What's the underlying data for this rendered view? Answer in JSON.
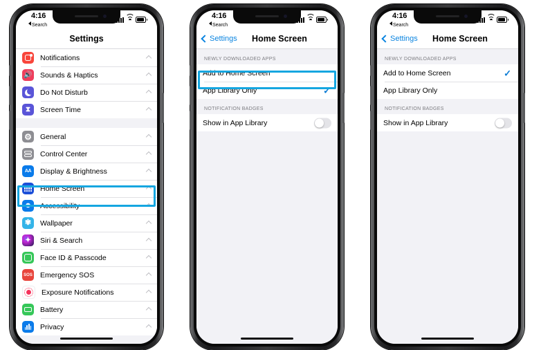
{
  "statusbar": {
    "time": "4:16",
    "back_label": "Search",
    "signal_icon": "cellular-bars-icon",
    "wifi_icon": "wifi-icon",
    "battery_icon": "battery-icon"
  },
  "phone1": {
    "nav": {
      "title": "Settings"
    },
    "group1": [
      {
        "label": "Notifications",
        "icon": "notifications-icon",
        "accessory": "chevron"
      },
      {
        "label": "Sounds & Haptics",
        "icon": "sounds-haptics-icon",
        "accessory": "chevron"
      },
      {
        "label": "Do Not Disturb",
        "icon": "do-not-disturb-icon",
        "accessory": "chevron"
      },
      {
        "label": "Screen Time",
        "icon": "screen-time-icon",
        "accessory": "chevron"
      }
    ],
    "group2": [
      {
        "label": "General",
        "icon": "general-gear-icon",
        "accessory": "chevron"
      },
      {
        "label": "Control Center",
        "icon": "control-center-icon",
        "accessory": "chevron"
      },
      {
        "label": "Display & Brightness",
        "icon": "display-brightness-icon",
        "accessory": "chevron"
      },
      {
        "label": "Home Screen",
        "icon": "home-screen-icon",
        "accessory": "chevron",
        "highlighted": true
      },
      {
        "label": "Accessibility",
        "icon": "accessibility-icon",
        "accessory": "chevron"
      },
      {
        "label": "Wallpaper",
        "icon": "wallpaper-icon",
        "accessory": "chevron"
      },
      {
        "label": "Siri & Search",
        "icon": "siri-search-icon",
        "accessory": "chevron"
      },
      {
        "label": "Face ID & Passcode",
        "icon": "face-id-icon",
        "accessory": "chevron"
      },
      {
        "label": "Emergency SOS",
        "icon": "emergency-sos-icon",
        "accessory": "chevron"
      },
      {
        "label": "Exposure Notifications",
        "icon": "exposure-notifications-icon",
        "accessory": "chevron"
      },
      {
        "label": "Battery",
        "icon": "battery-settings-icon",
        "accessory": "chevron"
      },
      {
        "label": "Privacy",
        "icon": "privacy-icon",
        "accessory": "chevron"
      }
    ],
    "display_brightness_badge": "AA",
    "sos_badge": "SOS"
  },
  "phone2": {
    "nav": {
      "back_label": "Settings",
      "title": "Home Screen"
    },
    "section1_header": "NEWLY DOWNLOADED APPS",
    "section1_rows": [
      {
        "label": "Add to Home Screen",
        "checked": false,
        "highlighted": true
      },
      {
        "label": "App Library Only",
        "checked": true,
        "highlighted": false
      }
    ],
    "section2_header": "NOTIFICATION BADGES",
    "section2_rows": [
      {
        "label": "Show in App Library",
        "toggle": "off"
      }
    ]
  },
  "phone3": {
    "nav": {
      "back_label": "Settings",
      "title": "Home Screen"
    },
    "section1_header": "NEWLY DOWNLOADED APPS",
    "section1_rows": [
      {
        "label": "Add to Home Screen",
        "checked": true,
        "highlighted": false
      },
      {
        "label": "App Library Only",
        "checked": false,
        "highlighted": false
      }
    ],
    "section2_header": "NOTIFICATION BADGES",
    "section2_rows": [
      {
        "label": "Show in App Library",
        "toggle": "off"
      }
    ]
  },
  "colors": {
    "highlight": "#15a6e0",
    "accent_blue": "#0a7bd4",
    "screen_bg": "#f2f2f6",
    "row_bg": "#ffffff"
  }
}
